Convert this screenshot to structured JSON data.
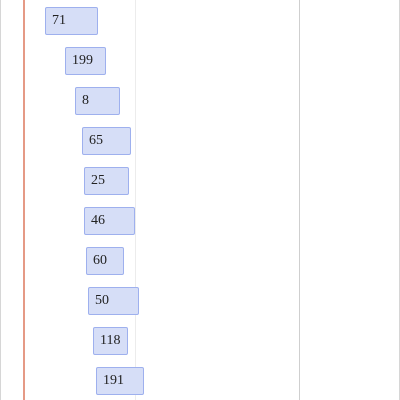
{
  "items": [
    {
      "label": "71"
    },
    {
      "label": "199"
    },
    {
      "label": "8"
    },
    {
      "label": "65"
    },
    {
      "label": "25"
    },
    {
      "label": "46"
    },
    {
      "label": "60"
    },
    {
      "label": "50"
    },
    {
      "label": "118"
    },
    {
      "label": "191"
    }
  ],
  "colors": {
    "item_fill": "#d6def7",
    "item_border": "#9eb0ee",
    "orange_guide": "#e59a86",
    "gray_guide": "#cfcfcf"
  }
}
